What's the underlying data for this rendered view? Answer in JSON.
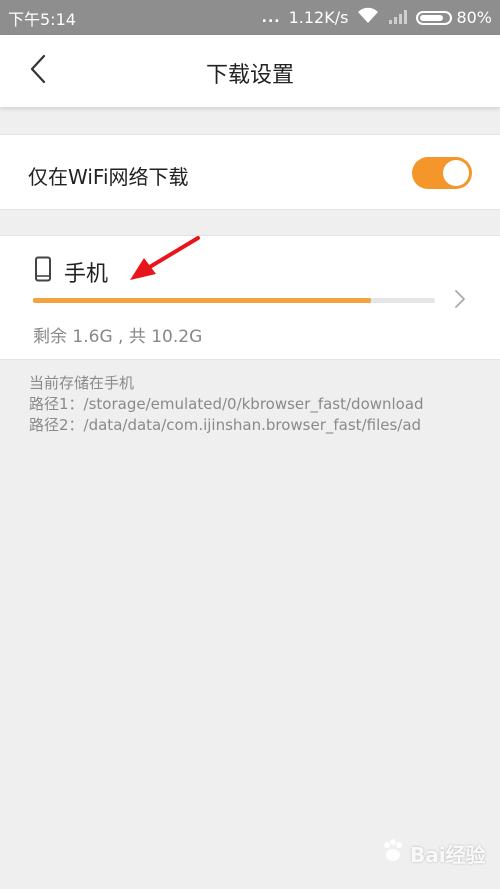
{
  "status_bar": {
    "time": "下午5:14",
    "dots": "...",
    "speed": "1.12K/s",
    "battery_percent": "80%",
    "battery_level": 0.8
  },
  "header": {
    "title": "下载设置",
    "back_icon": "chevron-left-icon"
  },
  "settings": {
    "wifi_only_label": "仅在WiFi网络下载",
    "wifi_only_enabled": true
  },
  "storage": {
    "name": "手机",
    "info": "剩余 1.6G , 共 10.2G",
    "used_fraction": 0.84,
    "icon": "phone-icon"
  },
  "paths": {
    "current": "当前存储在手机",
    "path1": "路径1：/storage/emulated/0/kbrowser_fast/download",
    "path2": "路径2：/data/data/com.ijinshan.browser_fast/files/ad"
  },
  "watermark": {
    "text": "Bai经验"
  },
  "colors": {
    "accent": "#f5962a",
    "annotation": "#e8161a"
  }
}
